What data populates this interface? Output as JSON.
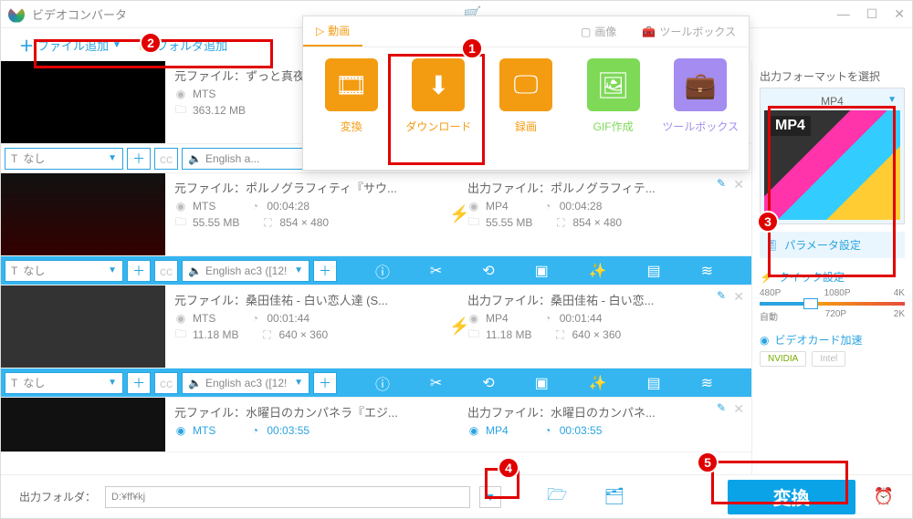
{
  "app": {
    "title": "ビデオコンバータ"
  },
  "window": {
    "cart": "🛒",
    "min": "—",
    "max": "☐",
    "close": "✕"
  },
  "toolbar": {
    "add_file": "ファイル追加",
    "add_folder": "フォルダ追加"
  },
  "popup": {
    "tabs": {
      "video": "動画",
      "image": "画像",
      "toolbox": "ツールボックス"
    },
    "cards": {
      "convert": "変換",
      "download": "ダウンロード",
      "record": "録画",
      "gif": "GIF作成",
      "toolbox": "ツールボックス"
    }
  },
  "labels": {
    "src_prefix": "元ファイル：",
    "dst_prefix": "出力ファイル：",
    "sub_none": "なし"
  },
  "files": [
    {
      "src": {
        "title": "ずっと真夜...",
        "fmt": "MTS",
        "size": "363.12 MB",
        "dur": "",
        "res": ""
      },
      "dst": null,
      "audio": "English a..."
    },
    {
      "src": {
        "title": "ポルノグラフィティ『サウ...",
        "fmt": "MTS",
        "size": "55.55 MB",
        "dur": "00:04:28",
        "res": "854 × 480"
      },
      "dst": {
        "title": "ポルノグラフィテ...",
        "fmt": "MP4",
        "size": "55.55 MB",
        "dur": "00:04:28",
        "res": "854 × 480"
      },
      "audio": "English ac3 ([12!"
    },
    {
      "src": {
        "title": "桑田佳祐 - 白い恋人達 (S...",
        "fmt": "MTS",
        "size": "11.18 MB",
        "dur": "00:01:44",
        "res": "640 × 360"
      },
      "dst": {
        "title": "桑田佳祐 - 白い恋...",
        "fmt": "MP4",
        "size": "11.18 MB",
        "dur": "00:01:44",
        "res": "640 × 360"
      },
      "audio": "English ac3 ([12!"
    },
    {
      "src": {
        "title": "水曜日のカンパネラ『エジ...",
        "fmt": "MTS",
        "size": "",
        "dur": "00:03:55",
        "res": ""
      },
      "dst": {
        "title": "水曜日のカンパネ...",
        "fmt": "MP4",
        "size": "",
        "dur": "00:03:55",
        "res": ""
      },
      "audio": ""
    }
  ],
  "right": {
    "heading": "出力フォーマットを選択",
    "format": "MP4",
    "thumb_label": "MP4",
    "param": "パラメータ設定",
    "quick": "クイック設定",
    "presets_top": [
      "480P",
      "1080P",
      "4K"
    ],
    "presets_bot": [
      "自動",
      "720P",
      "2K"
    ],
    "gpu": "ビデオカード加速",
    "nvidia": "NVIDIA",
    "intel": "Intel"
  },
  "bottom": {
    "label": "出力フォルダ：",
    "path": "D:¥ff¥kj",
    "convert": "変換"
  },
  "badges": {
    "b1": "1",
    "b2": "2",
    "b3": "3",
    "b4": "4",
    "b5": "5"
  }
}
